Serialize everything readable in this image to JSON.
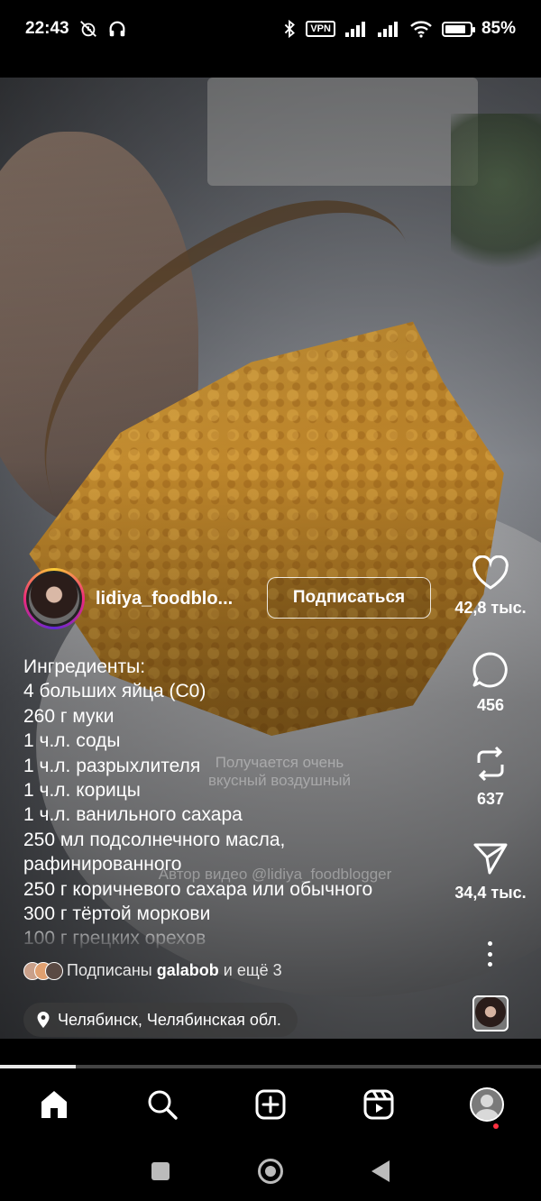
{
  "status_bar": {
    "time": "22:43",
    "vpn": "VPN",
    "battery": "85%",
    "battery_level": 0.85
  },
  "post": {
    "username": "lidiya_foodblo...",
    "follow_label": "Подписаться",
    "description_lines": [
      "Ингредиенты:",
      "4 больших яйца (С0)",
      "260 г муки",
      "1 ч.л. соды",
      "1 ч.л. разрыхлителя",
      "1 ч.л. корицы",
      "1 ч.л. ванильного сахара",
      "250 мл подсолнечного масла,",
      "рафинированного",
      "250 г коричневого сахара или обычного",
      "300 г тёртой моркови",
      "100 г грецких орехов"
    ],
    "followers_prefix": "Подписаны",
    "followers_name": "galabob",
    "followers_suffix": "и ещё 3",
    "location": "Челябинск, Челябинская обл.",
    "watermark_line1": "Получается очень",
    "watermark_line2": "вкусный воздушный",
    "watermark_author": "Автор видео @lidiya_foodblogger",
    "progress": 0.14
  },
  "actions": {
    "likes": "42,8 тыс.",
    "comments": "456",
    "reposts": "637",
    "shares": "34,4 тыс."
  },
  "colors": {
    "accent_red": "#ff3040",
    "story_ring": [
      "#f9ce34",
      "#ee2a7b",
      "#6228d7"
    ]
  }
}
